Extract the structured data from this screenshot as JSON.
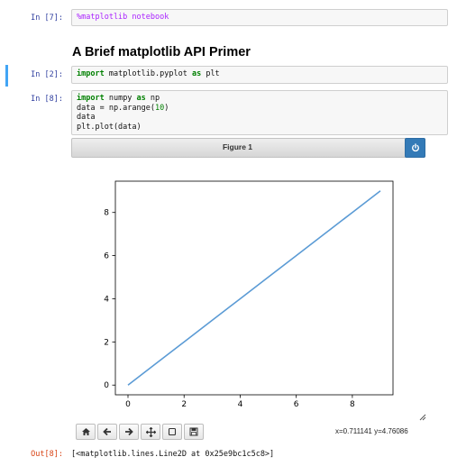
{
  "cells": {
    "magic": {
      "prompt": "In [7]:",
      "code": "%matplotlib notebook"
    },
    "heading": "A Brief matplotlib API Primer",
    "import_cell": {
      "prompt": "In [2]:",
      "kw1": "import",
      "mod": " matplotlib.pyplot ",
      "kw2": "as",
      "alias": " plt"
    },
    "data_cell": {
      "prompt": "In [8]:",
      "l1_kw1": "import",
      "l1_mod": " numpy ",
      "l1_kw2": "as",
      "l1_alias": " np",
      "l2_pre": "data = np.arange(",
      "l2_num": "10",
      "l2_post": ")",
      "l3": "data",
      "l4": "plt.plot(data)"
    }
  },
  "figure": {
    "title": "Figure 1",
    "coords": "x=0.711141 y=4.76086",
    "toolbar": [
      "home-icon",
      "back-arrow-icon",
      "forward-arrow-icon",
      "pan-icon",
      "zoom-rect-icon",
      "save-icon"
    ]
  },
  "output": {
    "prompt": "Out[8]:",
    "text": "[<matplotlib.lines.Line2D at 0x25e9bc1c5c8>]"
  },
  "colors": {
    "line": "#5b9bd5",
    "prompt_in": "#303f9f",
    "prompt_out": "#d84315",
    "power_button": "#337ab7"
  },
  "chart_data": {
    "type": "line",
    "x": [
      0,
      1,
      2,
      3,
      4,
      5,
      6,
      7,
      8,
      9
    ],
    "series": [
      {
        "values": [
          0,
          1,
          2,
          3,
          4,
          5,
          6,
          7,
          8,
          9
        ]
      }
    ],
    "xticks": [
      0,
      2,
      4,
      6,
      8
    ],
    "yticks": [
      0,
      2,
      4,
      6,
      8
    ],
    "xlim": [
      -0.45,
      9.45
    ],
    "ylim": [
      -0.45,
      9.45
    ],
    "grid": false
  }
}
